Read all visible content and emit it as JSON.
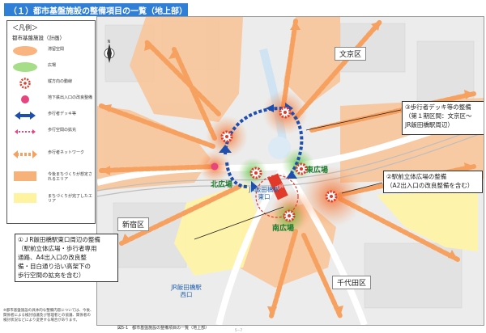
{
  "header": {
    "title": "（１）都市基盤施設の整備項目の一覧（地上部）"
  },
  "legend": {
    "title": "＜凡例＞",
    "subtitle": "都市基盤施設（計画）",
    "items": [
      {
        "label": "滞留空間",
        "symbol": "orange-blob"
      },
      {
        "label": "広場",
        "symbol": "green-blob"
      },
      {
        "label": "縦方向の動線",
        "symbol": "red-dotted-circle"
      },
      {
        "label": "地下鉄出入口の改良整備",
        "symbol": "pink-circle"
      },
      {
        "label": "歩行者デッキ等",
        "symbol": "blue-double-arrow"
      },
      {
        "label": "歩行空間の拡充",
        "symbol": "pink-dotted-arrow"
      },
      {
        "label": "歩行者ネットワーク",
        "symbol": "orange-double-arrow"
      },
      {
        "label": "今後まちづくりが想定されるエリア",
        "symbol": "orange-area"
      },
      {
        "label": "まちづくりが完了したエリア",
        "symbol": "yellow-area"
      }
    ]
  },
  "map": {
    "wards": {
      "bunkyo": "文京区",
      "shinjuku": "新宿区",
      "chiyoda": "千代田区"
    },
    "places": {
      "north_plaza": "北広場",
      "east_plaza": "東広場",
      "south_plaza": "南広場"
    },
    "stations": {
      "east_exit": "JR飯田橋駅\n東口",
      "west_exit": "JR飯田橋駅\n西口"
    },
    "stair_label": "階段"
  },
  "callouts": {
    "c1": "①ＪR飯田橋駅東口周辺の整備\n（駅前立体広場・歩行者専用\n通路、A4出入口の改良整\n備・目白通り沿い高架下の\n歩行空間の拡充を含む）",
    "c2": "②駅前立体広場の整備\n（A2出入口の改良整備を含む）",
    "c3": "③歩行者デッキ等の整備\n（第１期区間：文京区～\nJR飯田橋駅周辺）"
  },
  "footer": {
    "note": "※都市基盤施設の具体的な整備内容については、今後、関係者による検討協議及び管理者との協議、関係者の検討状況などにより変更する場合があります。",
    "caption": "図5-1　都市基盤施設の整備項目の一覧（地上部）",
    "page": "5－7"
  },
  "colors": {
    "header_bg": "#2f7fd6",
    "orange": "#f7a160",
    "green": "#8fd46b",
    "blue": "#1f4fae",
    "yellow": "#fff6b3",
    "pink": "#e8457f"
  }
}
